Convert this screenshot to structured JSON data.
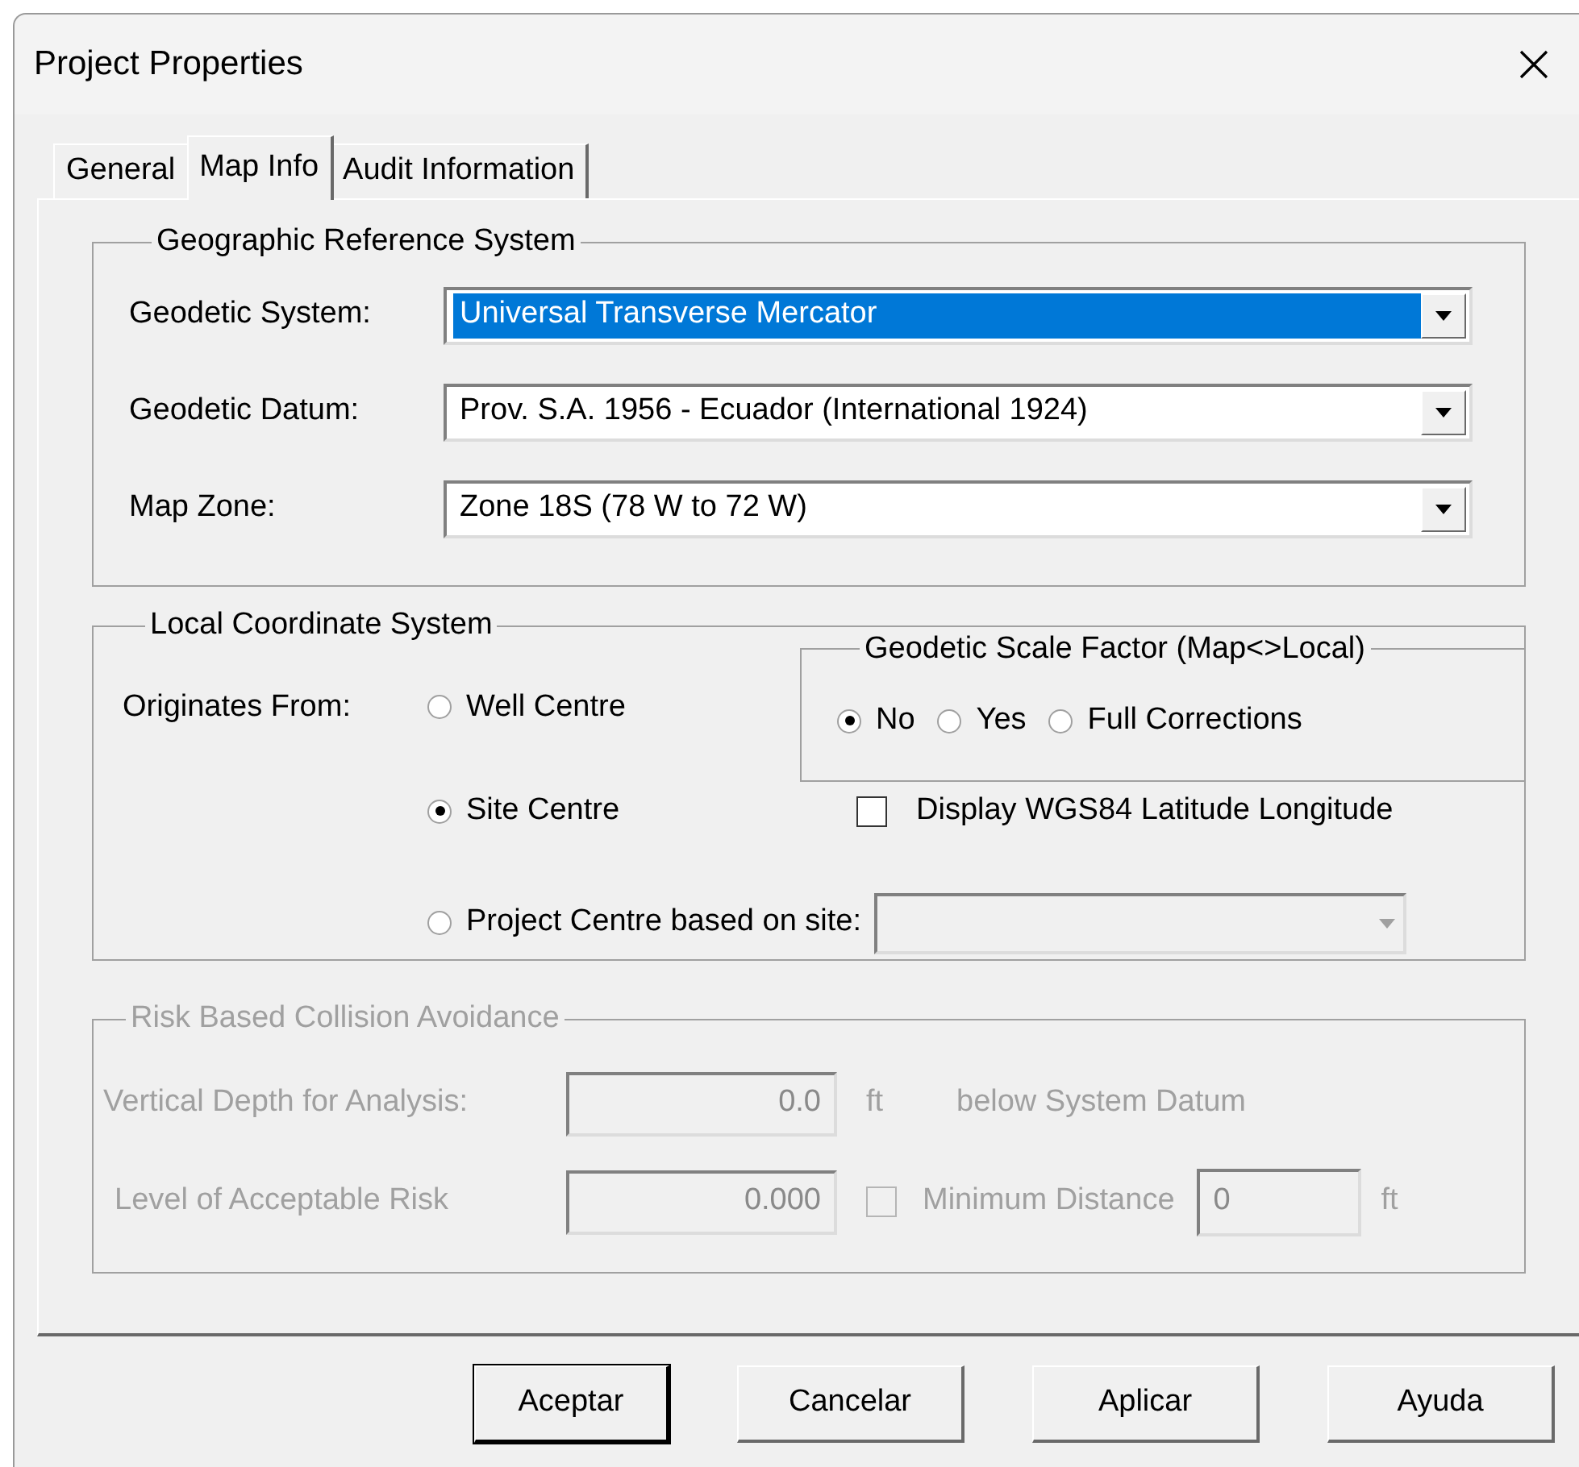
{
  "window": {
    "title": "Project Properties"
  },
  "tabs": [
    {
      "label": "General",
      "selected": false
    },
    {
      "label": "Map Info",
      "selected": true
    },
    {
      "label": "Audit Information",
      "selected": false
    }
  ],
  "geographic_reference_system": {
    "title": "Geographic Reference System",
    "fields": [
      {
        "label": "Geodetic System:",
        "value": "Universal Transverse Mercator",
        "focused": true
      },
      {
        "label": "Geodetic Datum:",
        "value": "Prov. S.A. 1956 - Ecuador (International 1924)",
        "focused": false
      },
      {
        "label": "Map Zone:",
        "value": "Zone 18S (78 W to 72 W)",
        "focused": false
      }
    ]
  },
  "local_coordinate_system": {
    "title": "Local Coordinate System",
    "originates_label": "Originates From:",
    "options": [
      {
        "label": "Well Centre",
        "selected": false
      },
      {
        "label": "Site Centre",
        "selected": true
      },
      {
        "label": "Project Centre based on site:",
        "selected": false
      }
    ]
  },
  "geodetic_scale_factor": {
    "title": "Geodetic Scale Factor (Map<>Local)",
    "options": [
      {
        "label": "No",
        "selected": true
      },
      {
        "label": "Yes",
        "selected": false
      },
      {
        "label": "Full Corrections",
        "selected": false
      }
    ]
  },
  "display_wgs84": {
    "label": "Display WGS84 Latitude Longitude",
    "checked": false
  },
  "risk_based_collision_avoidance": {
    "title": "Risk Based Collision Avoidance",
    "disabled": true,
    "vertical_depth": {
      "label": "Vertical Depth for Analysis:",
      "value": "0.0",
      "unit": "ft",
      "note": "below System Datum"
    },
    "acceptable_risk": {
      "label": "Level of Acceptable Risk",
      "value": "0.000"
    },
    "minimum_distance": {
      "label": "Minimum Distance",
      "value": "0",
      "unit": "ft",
      "checked": false
    }
  },
  "buttons": [
    {
      "label": "Aceptar",
      "default": true
    },
    {
      "label": "Cancelar",
      "default": false
    },
    {
      "label": "Aplicar",
      "default": false
    },
    {
      "label": "Ayuda",
      "default": false
    }
  ]
}
